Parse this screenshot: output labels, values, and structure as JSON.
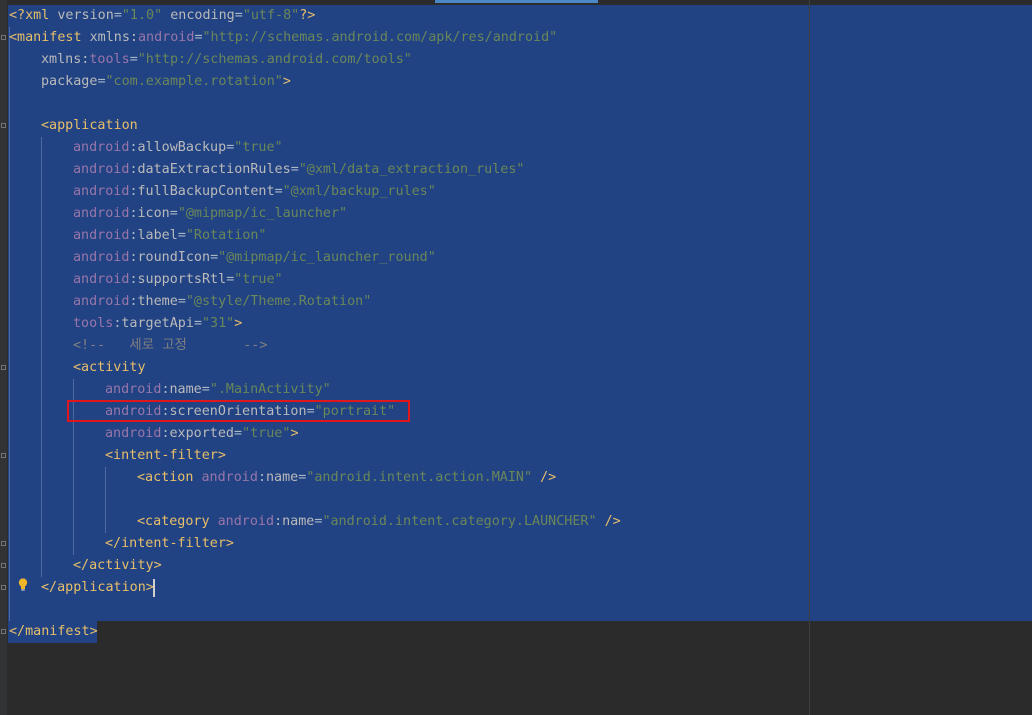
{
  "editor": {
    "colors": {
      "background": "#2b2b2b",
      "selection": "#214283",
      "tag": "#e8bf6a",
      "namespace": "#9876aa",
      "attribute": "#bababa",
      "value": "#6a8759",
      "comment": "#808080",
      "highlight_box": "#e0161d"
    },
    "lines": [
      {
        "indent": 0,
        "tokens": [
          [
            "tag",
            "<?xml "
          ],
          [
            "attr",
            "version"
          ],
          [
            "plain",
            "="
          ],
          [
            "val",
            "\"1.0\""
          ],
          [
            "plain",
            " "
          ],
          [
            "attr",
            "encoding"
          ],
          [
            "plain",
            "="
          ],
          [
            "val",
            "\"utf-8\""
          ],
          [
            "tag",
            "?>"
          ]
        ]
      },
      {
        "indent": 0,
        "tokens": [
          [
            "tag",
            "<manifest "
          ],
          [
            "attr",
            "xmlns:"
          ],
          [
            "ns",
            "android"
          ],
          [
            "plain",
            "="
          ],
          [
            "val",
            "\"http://schemas.android.com/apk/res/android\""
          ]
        ]
      },
      {
        "indent": 1,
        "tokens": [
          [
            "attr",
            "xmlns:"
          ],
          [
            "ns",
            "tools"
          ],
          [
            "plain",
            "="
          ],
          [
            "val",
            "\"http://schemas.android.com/tools\""
          ]
        ]
      },
      {
        "indent": 1,
        "tokens": [
          [
            "attr",
            "package"
          ],
          [
            "plain",
            "="
          ],
          [
            "val",
            "\"com.example.rotation\""
          ],
          [
            "tag",
            ">"
          ]
        ]
      },
      {
        "indent": 0,
        "tokens": []
      },
      {
        "indent": 1,
        "tokens": [
          [
            "tag",
            "<application"
          ]
        ]
      },
      {
        "indent": 2,
        "tokens": [
          [
            "ns",
            "android"
          ],
          [
            "plain",
            ":"
          ],
          [
            "attr",
            "allowBackup"
          ],
          [
            "plain",
            "="
          ],
          [
            "val",
            "\"true\""
          ]
        ]
      },
      {
        "indent": 2,
        "tokens": [
          [
            "ns",
            "android"
          ],
          [
            "plain",
            ":"
          ],
          [
            "attr",
            "dataExtractionRules"
          ],
          [
            "plain",
            "="
          ],
          [
            "val",
            "\"@xml/data_extraction_rules\""
          ]
        ]
      },
      {
        "indent": 2,
        "tokens": [
          [
            "ns",
            "android"
          ],
          [
            "plain",
            ":"
          ],
          [
            "attr",
            "fullBackupContent"
          ],
          [
            "plain",
            "="
          ],
          [
            "val",
            "\"@xml/backup_rules\""
          ]
        ]
      },
      {
        "indent": 2,
        "tokens": [
          [
            "ns",
            "android"
          ],
          [
            "plain",
            ":"
          ],
          [
            "attr",
            "icon"
          ],
          [
            "plain",
            "="
          ],
          [
            "val",
            "\"@mipmap/ic_launcher\""
          ]
        ]
      },
      {
        "indent": 2,
        "tokens": [
          [
            "ns",
            "android"
          ],
          [
            "plain",
            ":"
          ],
          [
            "attr",
            "label"
          ],
          [
            "plain",
            "="
          ],
          [
            "val",
            "\"Rotation\""
          ]
        ]
      },
      {
        "indent": 2,
        "tokens": [
          [
            "ns",
            "android"
          ],
          [
            "plain",
            ":"
          ],
          [
            "attr",
            "roundIcon"
          ],
          [
            "plain",
            "="
          ],
          [
            "val",
            "\"@mipmap/ic_launcher_round\""
          ]
        ]
      },
      {
        "indent": 2,
        "tokens": [
          [
            "ns",
            "android"
          ],
          [
            "plain",
            ":"
          ],
          [
            "attr",
            "supportsRtl"
          ],
          [
            "plain",
            "="
          ],
          [
            "val",
            "\"true\""
          ]
        ]
      },
      {
        "indent": 2,
        "tokens": [
          [
            "ns",
            "android"
          ],
          [
            "plain",
            ":"
          ],
          [
            "attr",
            "theme"
          ],
          [
            "plain",
            "="
          ],
          [
            "val",
            "\"@style/Theme.Rotation\""
          ]
        ]
      },
      {
        "indent": 2,
        "tokens": [
          [
            "ns",
            "tools"
          ],
          [
            "plain",
            ":"
          ],
          [
            "attr",
            "targetApi"
          ],
          [
            "plain",
            "="
          ],
          [
            "val",
            "\"31\""
          ],
          [
            "tag",
            ">"
          ]
        ]
      },
      {
        "indent": 2,
        "tokens": [
          [
            "com",
            "<!--   세로 고정       -->"
          ]
        ]
      },
      {
        "indent": 2,
        "tokens": [
          [
            "tag",
            "<activity"
          ]
        ]
      },
      {
        "indent": 3,
        "tokens": [
          [
            "ns",
            "android"
          ],
          [
            "plain",
            ":"
          ],
          [
            "attr",
            "name"
          ],
          [
            "plain",
            "="
          ],
          [
            "val",
            "\".MainActivity\""
          ]
        ]
      },
      {
        "indent": 3,
        "tokens": [
          [
            "ns",
            "android"
          ],
          [
            "plain",
            ":"
          ],
          [
            "attr",
            "screenOrientation"
          ],
          [
            "plain",
            "="
          ],
          [
            "val",
            "\"portrait\""
          ]
        ]
      },
      {
        "indent": 3,
        "tokens": [
          [
            "ns",
            "android"
          ],
          [
            "plain",
            ":"
          ],
          [
            "attr",
            "exported"
          ],
          [
            "plain",
            "="
          ],
          [
            "val",
            "\"true\""
          ],
          [
            "tag",
            ">"
          ]
        ]
      },
      {
        "indent": 3,
        "tokens": [
          [
            "tag",
            "<intent-filter>"
          ]
        ]
      },
      {
        "indent": 4,
        "tokens": [
          [
            "tag",
            "<action "
          ],
          [
            "ns",
            "android"
          ],
          [
            "plain",
            ":"
          ],
          [
            "attr",
            "name"
          ],
          [
            "plain",
            "="
          ],
          [
            "val",
            "\"android.intent.action.MAIN\""
          ],
          [
            "plain",
            " "
          ],
          [
            "tag",
            "/>"
          ]
        ]
      },
      {
        "indent": 0,
        "tokens": []
      },
      {
        "indent": 4,
        "tokens": [
          [
            "tag",
            "<category "
          ],
          [
            "ns",
            "android"
          ],
          [
            "plain",
            ":"
          ],
          [
            "attr",
            "name"
          ],
          [
            "plain",
            "="
          ],
          [
            "val",
            "\"android.intent.category.LAUNCHER\""
          ],
          [
            "plain",
            " "
          ],
          [
            "tag",
            "/>"
          ]
        ]
      },
      {
        "indent": 3,
        "tokens": [
          [
            "tag",
            "</intent-filter>"
          ]
        ]
      },
      {
        "indent": 2,
        "tokens": [
          [
            "tag",
            "</activity>"
          ]
        ]
      },
      {
        "indent": 1,
        "tokens": [
          [
            "tag",
            "</application>"
          ]
        ]
      },
      {
        "indent": 0,
        "tokens": []
      },
      {
        "indent": 0,
        "tokens": [
          [
            "tag",
            "</manifest>"
          ]
        ]
      }
    ],
    "highlighted_line_index": 18,
    "intention_icon": "lightbulb-icon"
  }
}
